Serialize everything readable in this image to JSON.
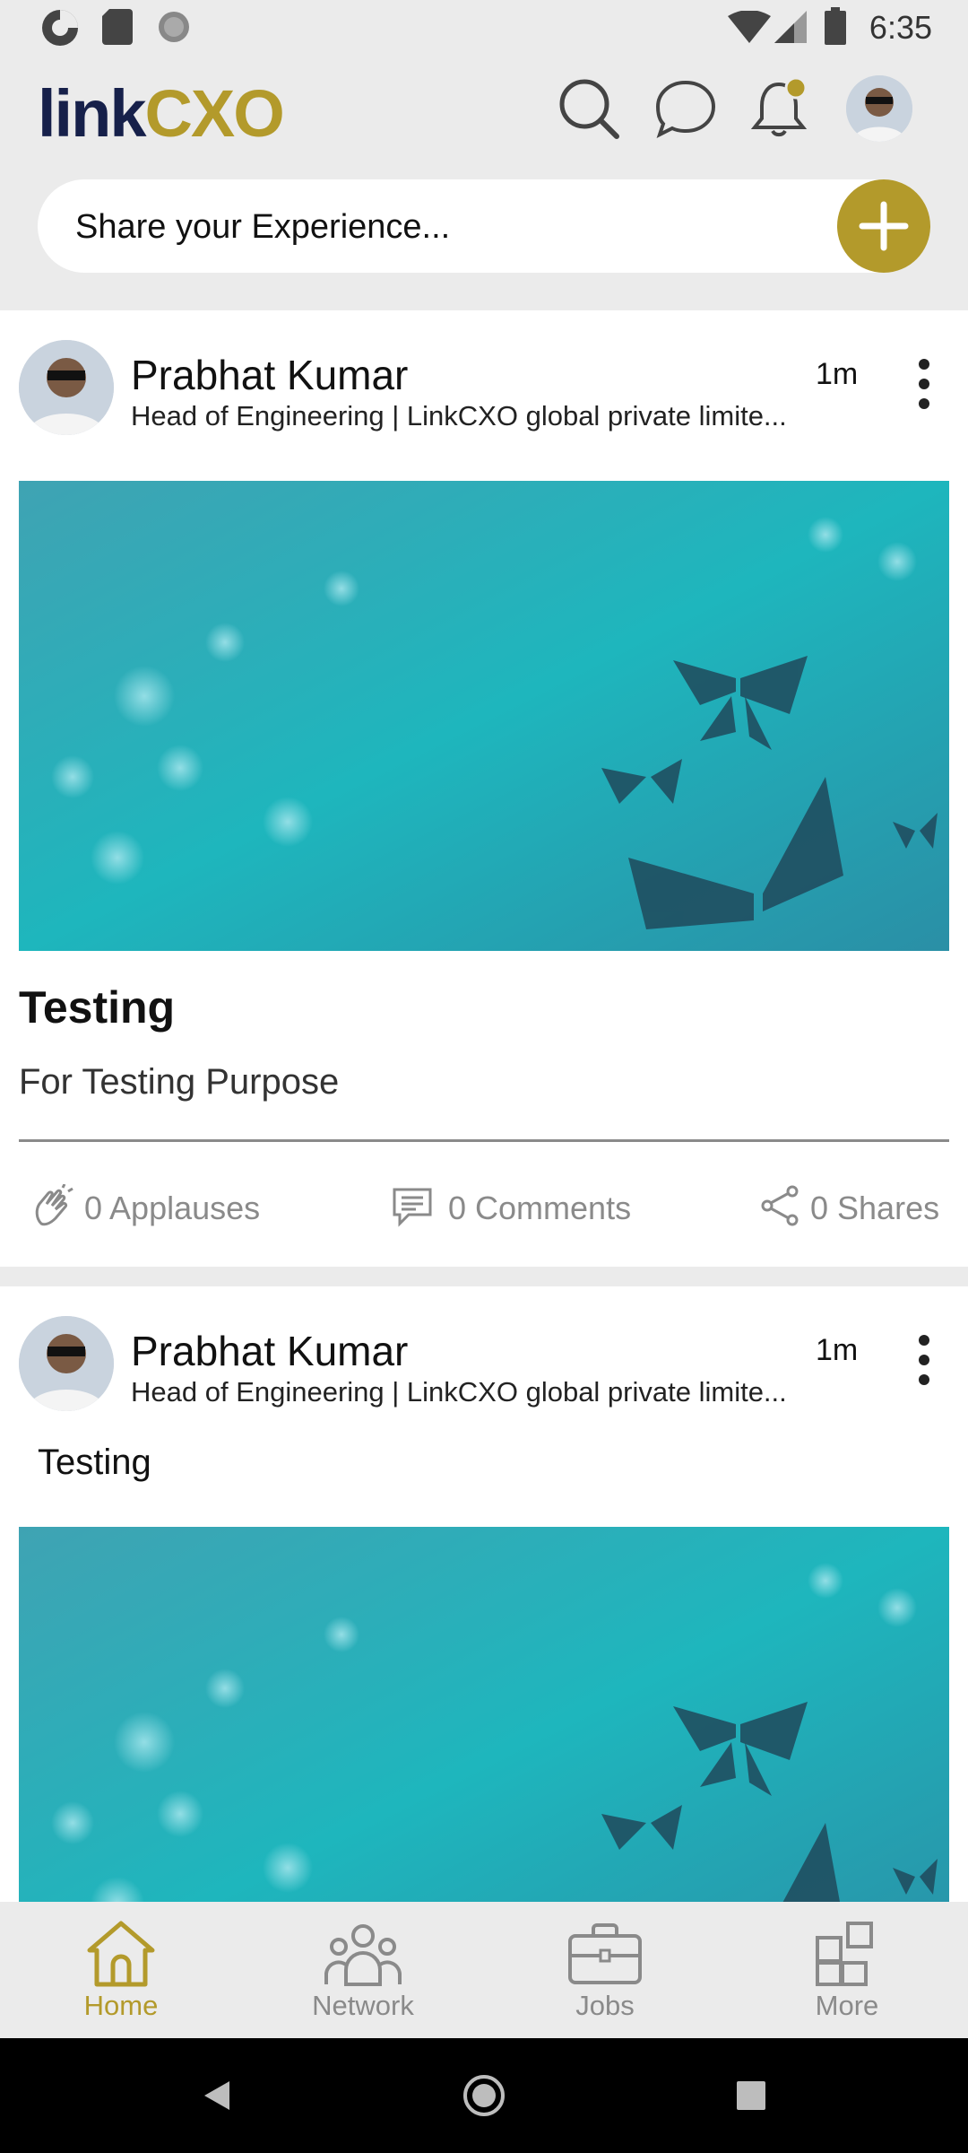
{
  "status_bar": {
    "time": "6:35"
  },
  "header": {
    "logo_part1": "link",
    "logo_part2": "CXO",
    "search_icon": "search-icon",
    "chat_icon": "chat-bubble-icon",
    "notification_icon": "bell-icon",
    "profile_avatar": "user-avatar"
  },
  "share": {
    "placeholder": "Share your Experience...",
    "add_icon": "plus-icon"
  },
  "posts": [
    {
      "author": "Prabhat Kumar",
      "author_title": "Head of Engineering | LinkCXO global private limite...",
      "time": "1m",
      "title": "Testing",
      "description": "For Testing Purpose",
      "applauses": "0 Applauses",
      "comments": "0 Comments",
      "shares": "0 Shares"
    },
    {
      "author": "Prabhat Kumar",
      "author_title": "Head of Engineering | LinkCXO global private limite...",
      "time": "1m",
      "text": "Testing"
    }
  ],
  "nav": {
    "items": [
      {
        "label": "Home",
        "icon": "home-icon",
        "active": true
      },
      {
        "label": "Network",
        "icon": "people-icon",
        "active": false
      },
      {
        "label": "Jobs",
        "icon": "briefcase-icon",
        "active": false
      },
      {
        "label": "More",
        "icon": "grid-icon",
        "active": false
      }
    ]
  },
  "colors": {
    "accent": "#b39a2b",
    "brand_dark": "#16204a",
    "background": "#ebebeb",
    "muted": "#8a8a8a"
  }
}
